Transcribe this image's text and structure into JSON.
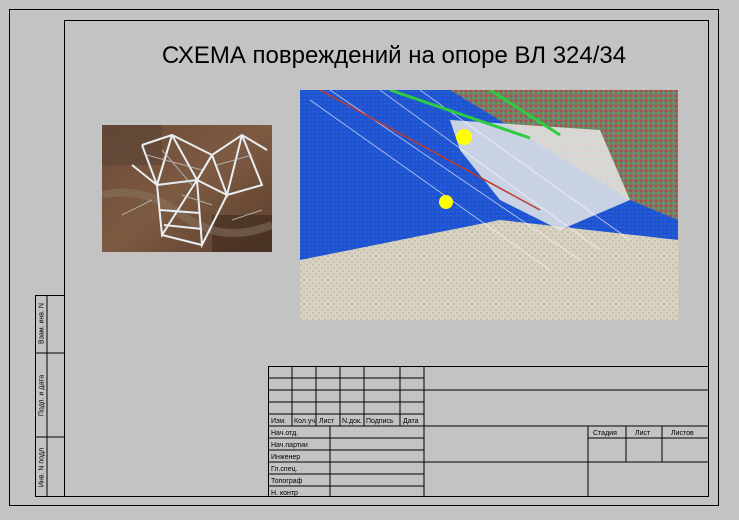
{
  "drawing": {
    "title": "СХЕМА повреждений на опоре ВЛ 324/34"
  },
  "side_stamp": {
    "labels": [
      "Взам. инв. N",
      "Подп. и дата",
      "Инв. N подл"
    ]
  },
  "title_block": {
    "revision_headers": [
      "Изм.",
      "Кол.уч.",
      "Лист",
      "N.док.",
      "Подпись",
      "Дата"
    ],
    "roles": [
      "Нач.отд.",
      "Нач.партии",
      "Инженер",
      "Гл.спец.",
      "Топограф",
      "Н. контр"
    ],
    "stage_headers": [
      "Стадия",
      "Лист",
      "Листов"
    ]
  },
  "images": {
    "photo": "tower-photo",
    "cloud": "point-cloud-scan"
  },
  "colors": {
    "background": "#c3c3c3",
    "marker": "#ffff00",
    "cloud_blue": "#1f4fd8",
    "cloud_green": "#2ecc40",
    "cloud_red": "#c0392b",
    "ground": "#d8d2c0"
  }
}
